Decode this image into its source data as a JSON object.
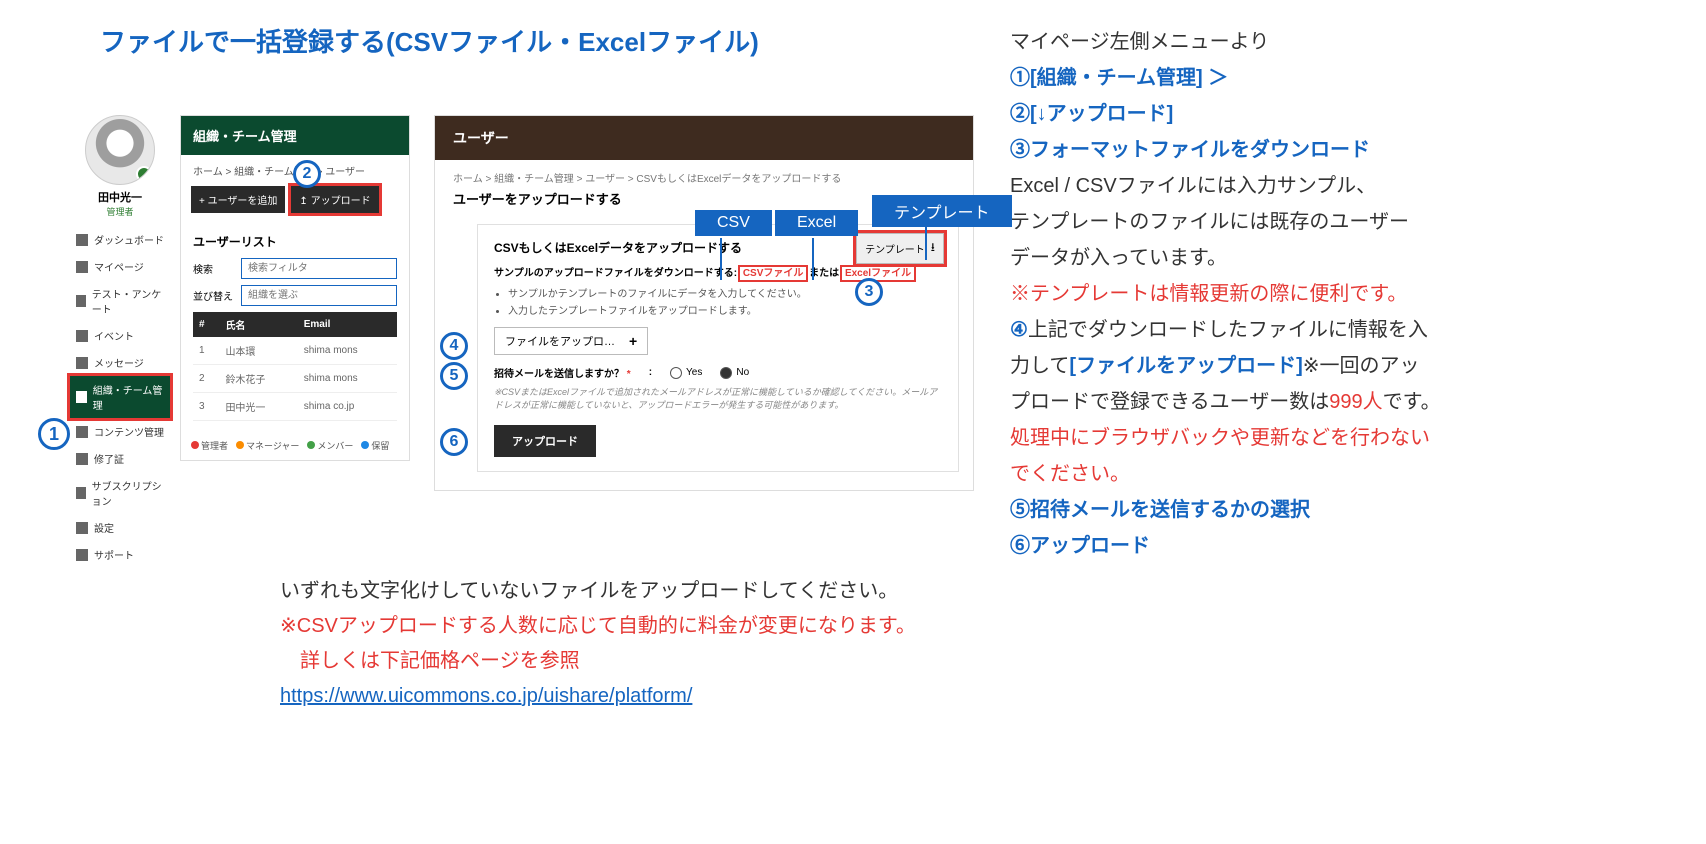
{
  "page_title": "ファイルで一括登録する(CSVファイル・Excelファイル)",
  "markers": {
    "m1": "1",
    "m2": "2",
    "m3": "3",
    "m4": "4",
    "m5": "5",
    "m6": "6"
  },
  "user": {
    "name": "田中光一",
    "role": "管理者"
  },
  "sidebar": {
    "items": [
      {
        "label": "ダッシュボード"
      },
      {
        "label": "マイページ"
      },
      {
        "label": "テスト・アンケート"
      },
      {
        "label": "イベント"
      },
      {
        "label": "メッセージ"
      },
      {
        "label": "組織・チーム管理"
      },
      {
        "label": "コンテンツ管理"
      },
      {
        "label": "修了証"
      },
      {
        "label": "サブスクリプション"
      },
      {
        "label": "設定"
      },
      {
        "label": "サポート"
      }
    ]
  },
  "appLeft": {
    "header": "組織・チーム管理",
    "crumbs": "ホーム > 組織・チーム管理 > ユーザー",
    "btn_add": "+ ユーザーを追加",
    "btn_upload": "↥ アップロード",
    "list_title": "ユーザーリスト",
    "search_label": "検索",
    "search_ph": "検索フィルタ",
    "sort_label": "並び替え",
    "sort_ph": "組織を選ぶ",
    "cols": {
      "idx": "#",
      "name": "氏名",
      "email": "Email"
    },
    "rows": [
      {
        "idx": "1",
        "name": "山本環",
        "email": "shima\nmons"
      },
      {
        "idx": "2",
        "name": "鈴木花子",
        "email": "shima\nmons"
      },
      {
        "idx": "3",
        "name": "田中光一",
        "email": "shima\nco.jp"
      }
    ],
    "legend": {
      "admin": "管理者",
      "manager": "マネージャー",
      "member": "メンバー",
      "pending": "保留"
    }
  },
  "appMain": {
    "header": "ユーザー",
    "crumbs": "ホーム > 組織・チーム管理 > ユーザー > CSVもしくはExcelデータをアップロードする",
    "title": "ユーザーをアップロードする",
    "card_title": "CSVもしくはExcelデータをアップロードする",
    "sample_prefix": "サンプルのアップロードファイルをダウンロードする: ",
    "csv_link": "CSVファイル",
    "mid": " または ",
    "excel_link": "Excelファイル",
    "bullet1": "サンプルかテンプレートのファイルにデータを入力してください。",
    "bullet2": "入力したテンプレートファイルをアップロードします。",
    "file_btn": "ファイルをアップロ…",
    "question": "招待メールを送信しますか？",
    "yes": "Yes",
    "no": "No",
    "note": "※CSVまたはExcelファイルで追加されたメールアドレスが正常に機能しているか確認してください。メールアドレスが正常に機能していないと、アップロードエラーが発生する可能性があります。",
    "upload_btn": "アップロード",
    "tpl_btn": "テンプレート"
  },
  "tags": {
    "csv": "CSV",
    "excel": "Excel",
    "tpl": "テンプレート"
  },
  "right": {
    "l0": "マイページ左側メニューより",
    "l1a": "①",
    "l1b": "[組織・チーム管理] ＞",
    "l2a": "②",
    "l2b": "[↓アップロード]",
    "l3a": "③",
    "l3b": "フォーマットファイルをダウンロード",
    "l4": "Excel / CSVファイルには入力サンプル、",
    "l5": "テンプレートのファイルには既存のユーザー",
    "l6": "データが入っています。",
    "l7": "※テンプレートは情報更新の際に便利です。",
    "l8a": "④",
    "l8b": "上記でダウンロードしたファイルに情報を入",
    "l9a": "力して",
    "l9b": "[ファイルをアップロード]",
    "l9c": "※一回のアッ",
    "l10a": "プロードで登録できるユーザー数は",
    "l10b": "999人",
    "l10c": "です。",
    "l11": "処理中にブラウザバックや更新などを行わない",
    "l12": "でください。",
    "l13a": "⑤",
    "l13b": "招待メールを送信するかの選択",
    "l14a": "⑥",
    "l14b": "アップロード"
  },
  "bottom": {
    "l1": "いずれも文字化けしていないファイルをアップロードしてください。",
    "l2": "※CSVアップロードする人数に応じて自動的に料金が変更になります。",
    "l3": "　詳しくは下記価格ページを参照",
    "link": "https://www.uicommons.co.jp/uishare/platform/"
  }
}
